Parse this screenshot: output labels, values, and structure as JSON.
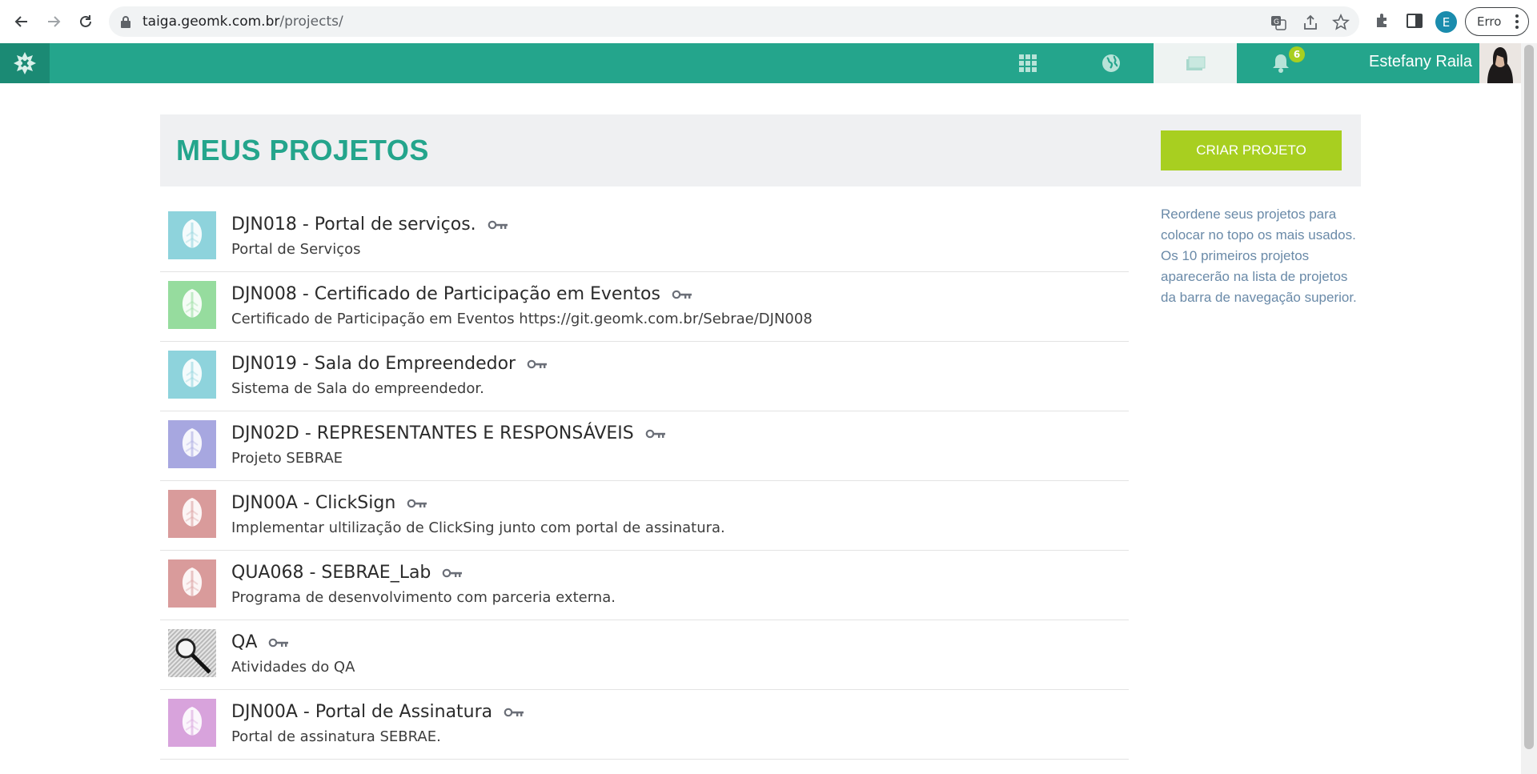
{
  "browser": {
    "url_host": "taiga.geomk.com.br",
    "url_path": "/projects/",
    "profile_initial": "E",
    "error_label": "Erro"
  },
  "topbar": {
    "user_name": "Estefany Raila",
    "notification_count": "6",
    "nav_icons": [
      "apps-grid-icon",
      "globe-icon",
      "projects-folder-icon",
      "bell-icon"
    ]
  },
  "header": {
    "title": "MEUS PROJETOS",
    "create_button": "CRIAR PROJETO"
  },
  "projects": [
    {
      "title": "DJN018 - Portal de serviços.",
      "description": "Portal de Serviços",
      "color": "#8ed3dc",
      "private": true
    },
    {
      "title": "DJN008 - Certificado de Participação em Eventos",
      "description": "Certificado de Participação em Eventos https://git.geomk.com.br/Sebrae/DJN008",
      "color": "#96dc9e",
      "private": true
    },
    {
      "title": "DJN019 - Sala do Empreendedor",
      "description": "Sistema de Sala do empreendedor.",
      "color": "#8ed3dc",
      "private": true
    },
    {
      "title": "DJN02D - REPRESENTANTES E RESPONSÁVEIS",
      "description": "Projeto SEBRAE",
      "color": "#a7a7e0",
      "private": true
    },
    {
      "title": "DJN00A - ClickSign",
      "description": "Implementar ultilização de ClickSing junto com portal de assinatura.",
      "color": "#d99b9b",
      "private": true
    },
    {
      "title": "QUA068 - SEBRAE_Lab",
      "description": "Programa de desenvolvimento com parceria externa.",
      "color": "#d99b9b",
      "private": true
    },
    {
      "title": "QA",
      "description": "Atividades do QA",
      "color": "#d8d8d8",
      "private": true
    },
    {
      "title": "DJN00A - Portal de Assinatura",
      "description": "Portal de assinatura SEBRAE.",
      "color": "#d8a3dc",
      "private": true
    }
  ],
  "sidebar": {
    "line1": "Reordene seus projetos para colocar no topo os mais usados.",
    "line2": "Os 10 primeiros projetos aparecerão na lista de projetos da barra de navegação superior."
  },
  "colors": {
    "brand": "#24a58c",
    "brand_dark": "#1b8a74",
    "accent": "#a8cf20",
    "sidebar_text": "#6a8aa8"
  }
}
